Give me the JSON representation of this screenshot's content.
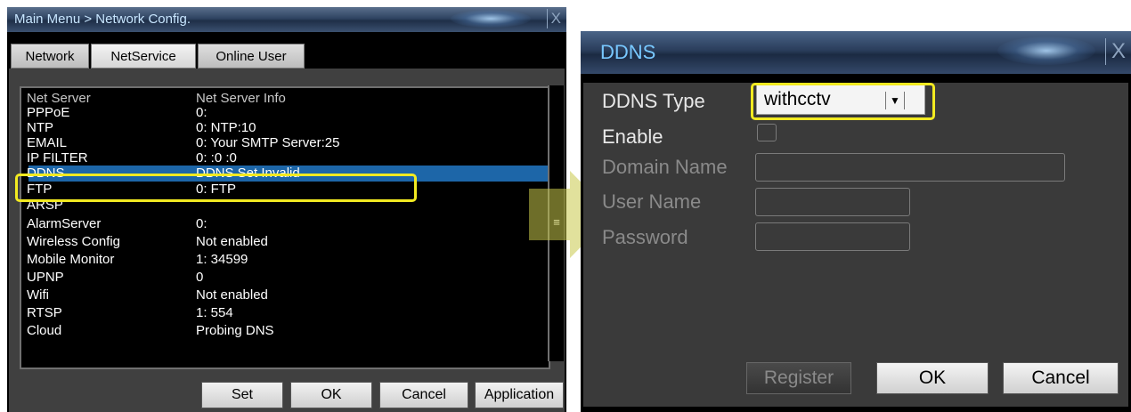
{
  "network_config": {
    "title": "Main Menu > Network Config.",
    "close": "X",
    "tabs": [
      {
        "label": "Network"
      },
      {
        "label": "NetService"
      },
      {
        "label": "Online User"
      }
    ],
    "columns": [
      "Net Server",
      "Net Server Info"
    ],
    "rows": [
      {
        "server": "PPPoE",
        "info": "0:"
      },
      {
        "server": "NTP",
        "info": "0: NTP:10"
      },
      {
        "server": "EMAIL",
        "info": "0: Your SMTP Server:25"
      },
      {
        "server": "IP FILTER",
        "info": "0: :0 :0"
      },
      {
        "server": "DDNS",
        "info": "DDNS Set Invalid"
      },
      {
        "server": "FTP",
        "info": "0: FTP"
      },
      {
        "server": "ARSP",
        "info": ""
      },
      {
        "server": "AlarmServer",
        "info": "0:"
      },
      {
        "server": "Wireless Config",
        "info": "Not enabled"
      },
      {
        "server": "Mobile Monitor",
        "info": "1: 34599"
      },
      {
        "server": "UPNP",
        "info": "0"
      },
      {
        "server": "Wifi",
        "info": "Not enabled"
      },
      {
        "server": "RTSP",
        "info": "1: 554"
      },
      {
        "server": "Cloud",
        "info": "Probing DNS"
      }
    ],
    "selected_row": "DDNS",
    "scroll_glyph": "≡",
    "buttons": {
      "set": "Set",
      "ok": "OK",
      "cancel": "Cancel",
      "application": "Application"
    }
  },
  "ddns_dialog": {
    "title": "DDNS",
    "close": "X",
    "ddns_type_label": "DDNS Type",
    "ddns_type_value": "withcctv",
    "dropdown_glyph": "▼",
    "enable_label": "Enable",
    "enable_checked": false,
    "domain_name_label": "Domain Name",
    "domain_name_value": "",
    "user_name_label": "User Name",
    "user_name_value": "",
    "password_label": "Password",
    "password_value": "",
    "buttons": {
      "register": "Register",
      "ok": "OK",
      "cancel": "Cancel"
    }
  },
  "colors": {
    "highlight": "#f2ea21",
    "selection": "#1d66a8",
    "arrow": "#c8c84a",
    "title_text": "#78c8ff"
  }
}
